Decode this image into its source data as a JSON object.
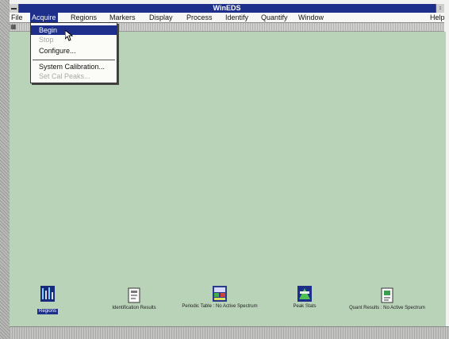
{
  "window": {
    "title": "WinEDS"
  },
  "window_buttons": {
    "restore": "↕",
    "menu_glyph": ""
  },
  "menubar": {
    "items": [
      {
        "label": "File"
      },
      {
        "label": "Acquire"
      },
      {
        "label": "Regions"
      },
      {
        "label": "Markers"
      },
      {
        "label": "Display"
      },
      {
        "label": "Process"
      },
      {
        "label": "Identify"
      },
      {
        "label": "Quantify"
      },
      {
        "label": "Window"
      },
      {
        "label": "Help"
      }
    ]
  },
  "acquire_menu": {
    "items": [
      {
        "label": "Begin",
        "state": "highlighted"
      },
      {
        "label": "Stop",
        "state": "disabled"
      },
      {
        "label": "Configure...",
        "state": "enabled"
      },
      {
        "label": "System Calibration...",
        "state": "enabled"
      },
      {
        "label": "Set Cal Peaks...",
        "state": "disabled"
      }
    ]
  },
  "minimized_windows": [
    {
      "label": "Regions",
      "icon": "regions-icon",
      "selected": true
    },
    {
      "label": "Identification Results",
      "icon": "identification-results-icon",
      "selected": false
    },
    {
      "label": "Periodic Table : No Active Spectrum",
      "icon": "periodic-table-icon",
      "selected": false
    },
    {
      "label": "Peak Stats",
      "icon": "peak-stats-icon",
      "selected": false
    },
    {
      "label": "Quant Results : No Active Spectrum",
      "icon": "quant-results-icon",
      "selected": false
    }
  ],
  "colors": {
    "titlebar": "#1d2f8a",
    "workspace": "#b9d3b8",
    "menu_highlight": "#1d2f8a"
  }
}
